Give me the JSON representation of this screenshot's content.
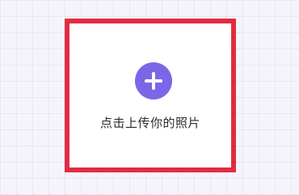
{
  "upload": {
    "label": "点击上传你的照片",
    "icon": "plus-icon",
    "accent_color": "#7c66e8",
    "highlight_color": "#e12c40"
  }
}
